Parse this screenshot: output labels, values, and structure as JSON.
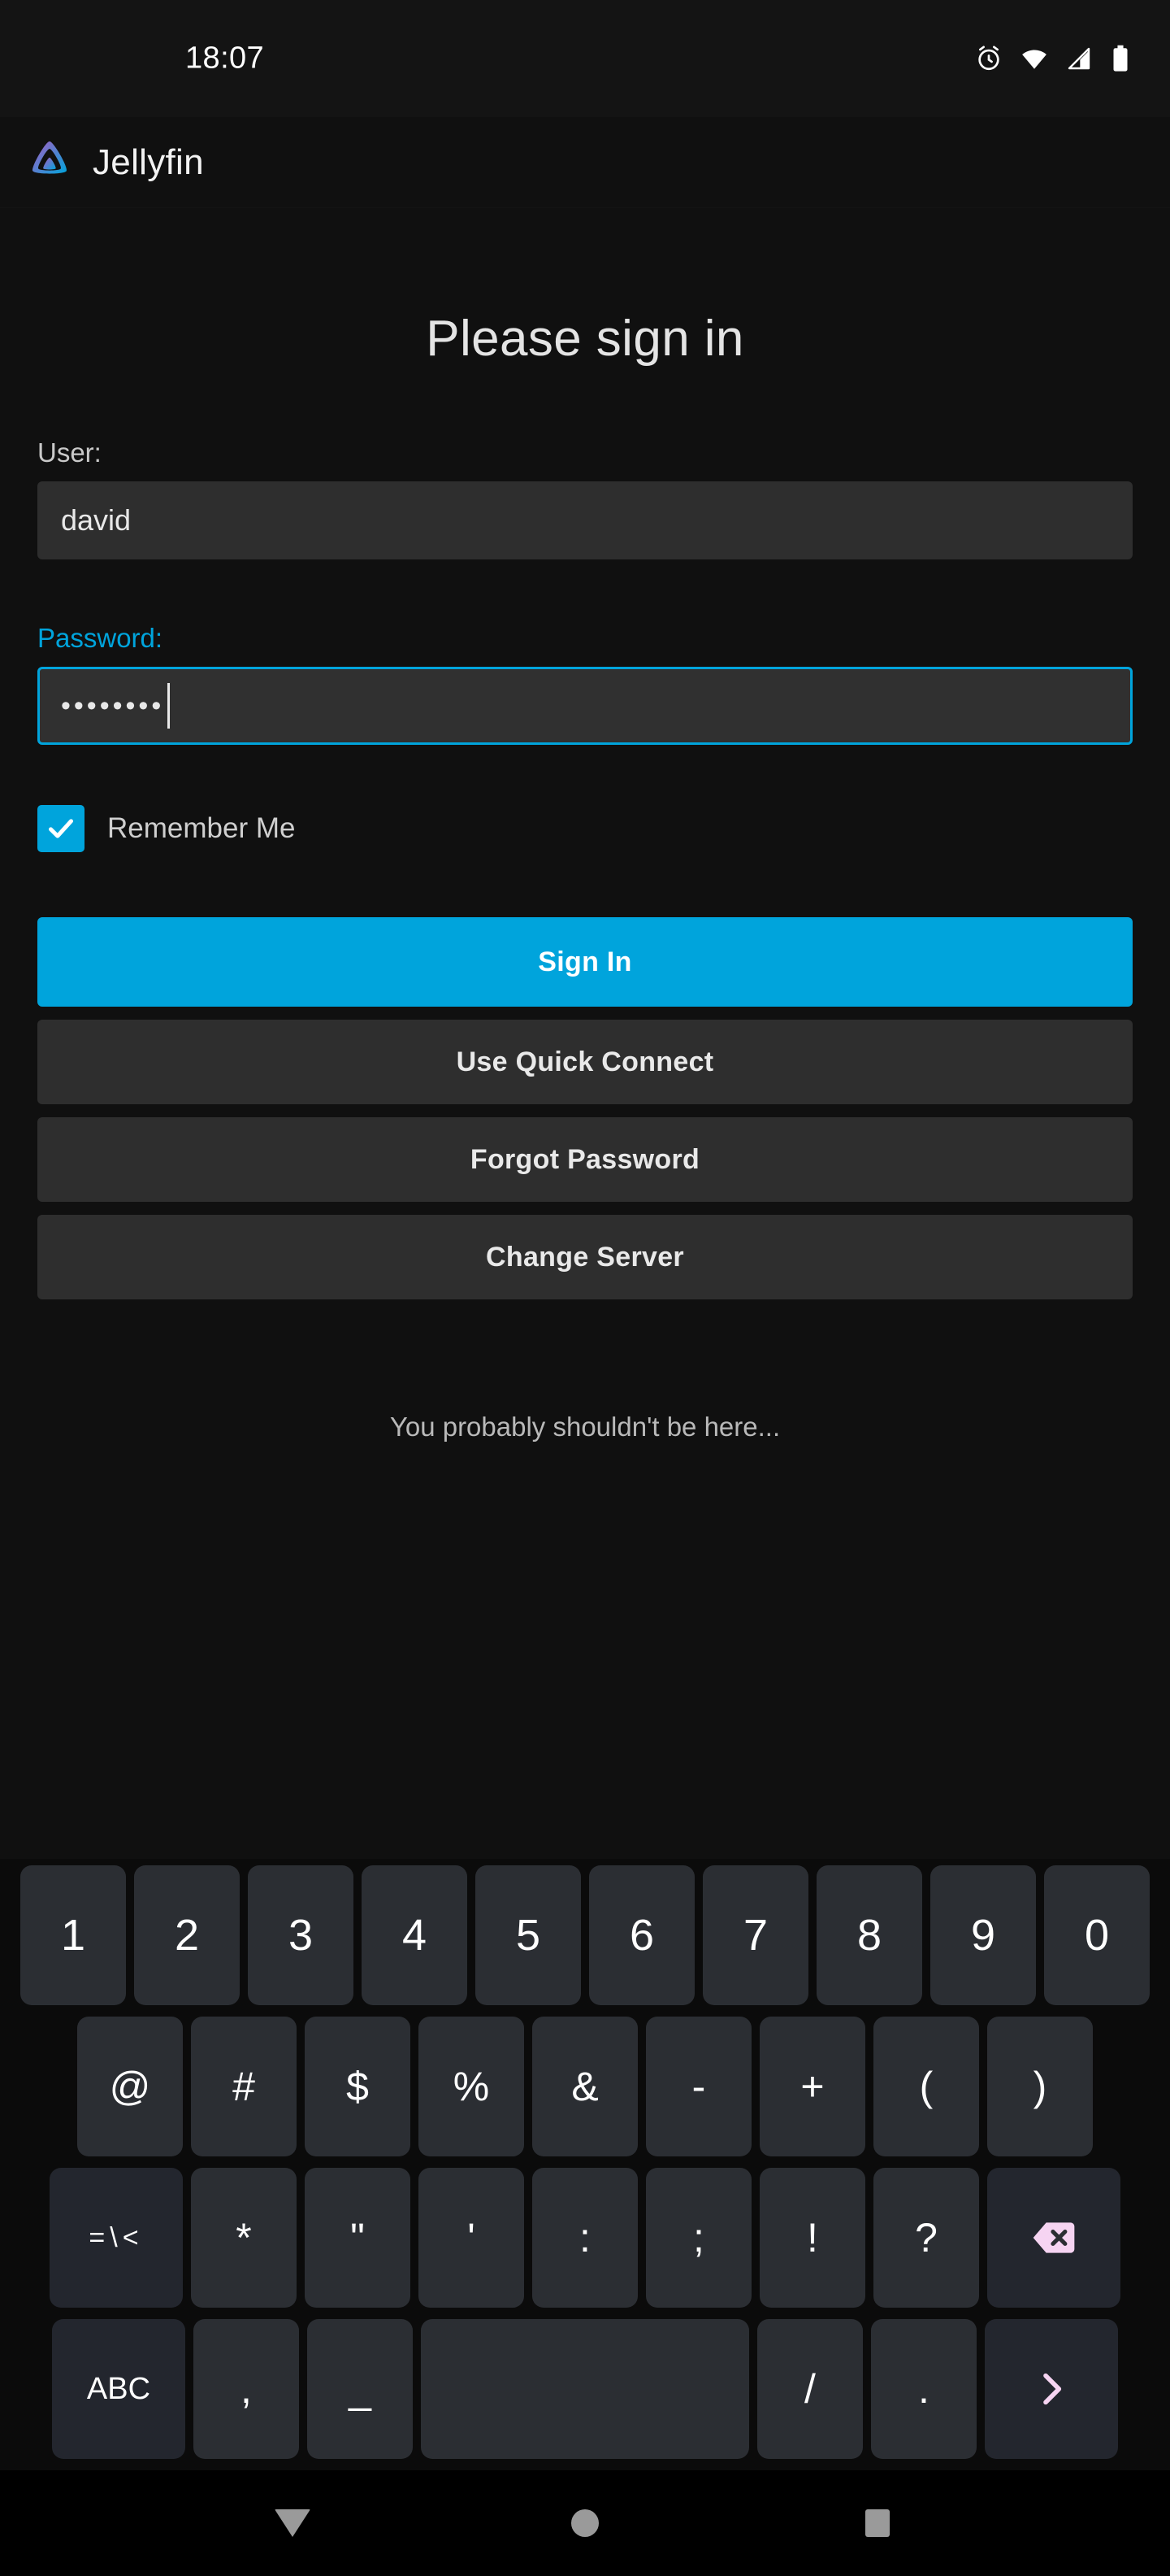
{
  "status_bar": {
    "time": "18:07",
    "icons": [
      "alarm-clock-icon",
      "wifi-icon",
      "cell-signal-icon",
      "battery-icon"
    ]
  },
  "app_header": {
    "brand_name": "Jellyfin",
    "logo_icon": "jellyfin-logo-icon",
    "logo_gradient_from": "#AA5CC3",
    "logo_gradient_to": "#00A4DC"
  },
  "login": {
    "title": "Please sign in",
    "user_label": "User:",
    "user_value": "david",
    "password_label": "Password:",
    "password_value": "••••••••",
    "password_focused": true,
    "remember_label": "Remember Me",
    "remember_checked": true,
    "buttons": {
      "sign_in": "Sign In",
      "quick_connect": "Use Quick Connect",
      "forgot_password": "Forgot Password",
      "change_server": "Change Server"
    },
    "footer_note": "You probably shouldn't be here...",
    "accent_color": "#00A4DC"
  },
  "keyboard": {
    "row1": [
      "1",
      "2",
      "3",
      "4",
      "5",
      "6",
      "7",
      "8",
      "9",
      "0"
    ],
    "row2": [
      "@",
      "#",
      "$",
      "%",
      "&",
      "-",
      "+",
      "(",
      ")"
    ],
    "row3": [
      "=\\<",
      "*",
      "\"",
      "'",
      ":",
      ";",
      "!",
      "?"
    ],
    "row3_backspace_icon": "backspace-icon",
    "row4": {
      "abc": "ABC",
      "comma": ",",
      "underscore": "_",
      "space": "",
      "slash": "/",
      "period": ".",
      "enter_icon": "chevron-right-icon"
    },
    "accent_key_color": "#F6D4F2"
  },
  "nav_bar": {
    "back": "back-icon",
    "home": "home-icon",
    "recents": "recents-icon"
  }
}
